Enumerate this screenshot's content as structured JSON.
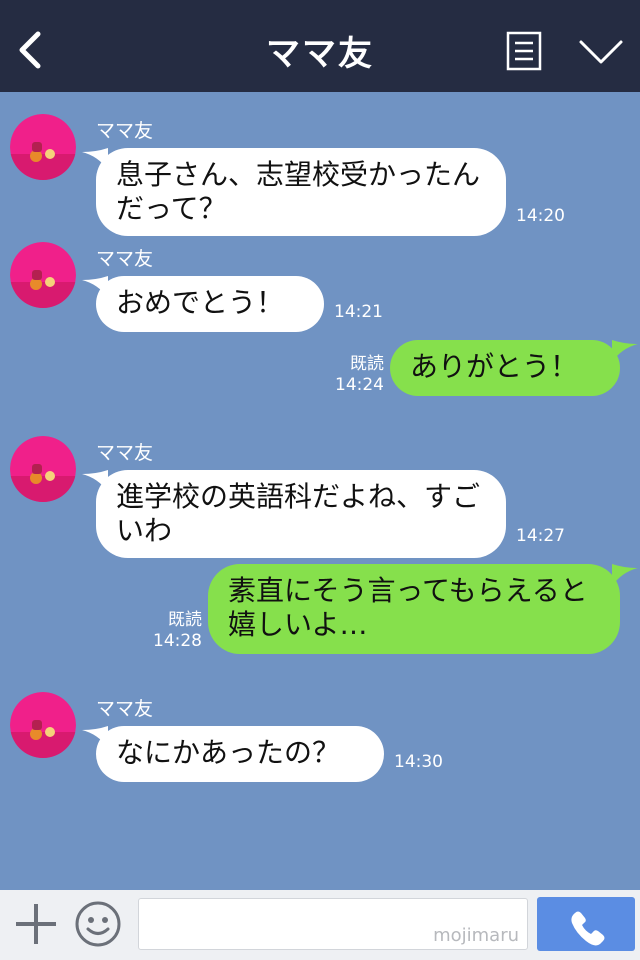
{
  "header": {
    "title": "ママ友",
    "back_icon": "chevron-left-icon",
    "menu_icon": "menu-list-icon",
    "dropdown_icon": "chevron-down-icon"
  },
  "colors": {
    "header_bg": "#252c42",
    "chat_bg": "#7093c3",
    "incoming_bubble": "#ffffff",
    "outgoing_bubble": "#86e04c",
    "call_button": "#5b8de3"
  },
  "messages": [
    {
      "side": "left",
      "sender": "ママ友",
      "text": "息子さん、志望校受かったんだって？",
      "time": "14:20"
    },
    {
      "side": "left",
      "sender": "ママ友",
      "text": "おめでとう！",
      "time": "14:21"
    },
    {
      "side": "right",
      "read": "既読",
      "text": "ありがとう！",
      "time": "14:24"
    },
    {
      "side": "left",
      "sender": "ママ友",
      "text": "進学校の英語科だよね、すごいわ",
      "time": "14:27"
    },
    {
      "side": "right",
      "read": "既読",
      "text": "素直にそう言ってもらえると嬉しいよ…",
      "time": "14:28"
    },
    {
      "side": "left",
      "sender": "ママ友",
      "text": "なにかあったの？",
      "time": "14:30"
    }
  ],
  "footer": {
    "plus_icon": "plus-icon",
    "emoji_icon": "smiley-icon",
    "input_value": "",
    "watermark": "mojimaru",
    "call_icon": "phone-icon"
  }
}
